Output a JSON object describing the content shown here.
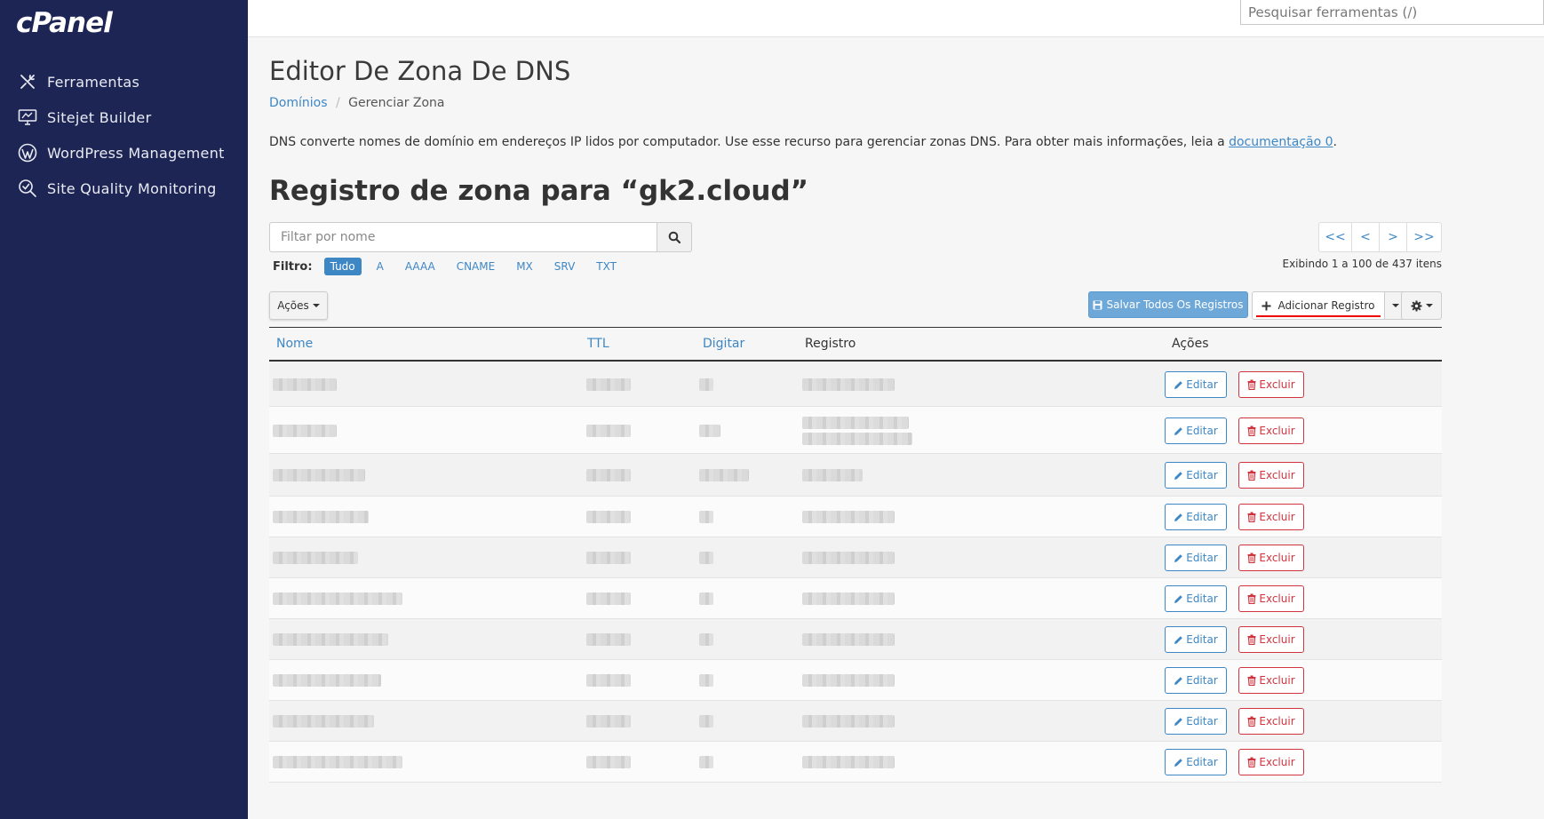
{
  "brand": {
    "logo": "cPanel",
    "sidebar_bg": "#1d2554",
    "accent": "#3e87c5",
    "danger": "#d1343e"
  },
  "sidebar": {
    "items": [
      {
        "label": "Ferramentas",
        "icon": "tools-icon"
      },
      {
        "label": "Sitejet Builder",
        "icon": "monitor-icon"
      },
      {
        "label": "WordPress Management",
        "icon": "wordpress-icon"
      },
      {
        "label": "Site Quality Monitoring",
        "icon": "search-check-icon"
      }
    ]
  },
  "topbar": {
    "search_placeholder": "Pesquisar ferramentas (/)"
  },
  "page": {
    "title": "Editor De Zona De DNS",
    "breadcrumb": {
      "link": "Domínios",
      "separator": "/",
      "current": "Gerenciar Zona"
    },
    "intro_text": "DNS converte nomes de domínio em endereços IP lidos por computador. Use esse recurso para gerenciar zonas DNS. Para obter mais informações, leia a ",
    "intro_link": "documentação 0",
    "intro_end": ".",
    "zone_title": "Registro de zona para “gk2.cloud”"
  },
  "filter": {
    "placeholder": "Filtar por nome",
    "label": "Filtro:",
    "types": [
      "Tudo",
      "A",
      "AAAA",
      "CNAME",
      "MX",
      "SRV",
      "TXT"
    ],
    "active": "Tudo"
  },
  "pager": {
    "first": "<<",
    "prev": "<",
    "next": ">",
    "last": ">>",
    "showing": "Exibindo 1 a 100 de 437 itens"
  },
  "toolbar": {
    "actions_label": "Ações",
    "save_all_label": "Salvar Todos Os Registros",
    "add_record_label": "Adicionar Registro"
  },
  "table": {
    "headers": {
      "name": "Nome",
      "ttl": "TTL",
      "type": "Digitar",
      "record": "Registro",
      "actions": "Ações"
    },
    "edit_label": "Editar",
    "delete_label": "Excluir",
    "row_count": 10
  }
}
